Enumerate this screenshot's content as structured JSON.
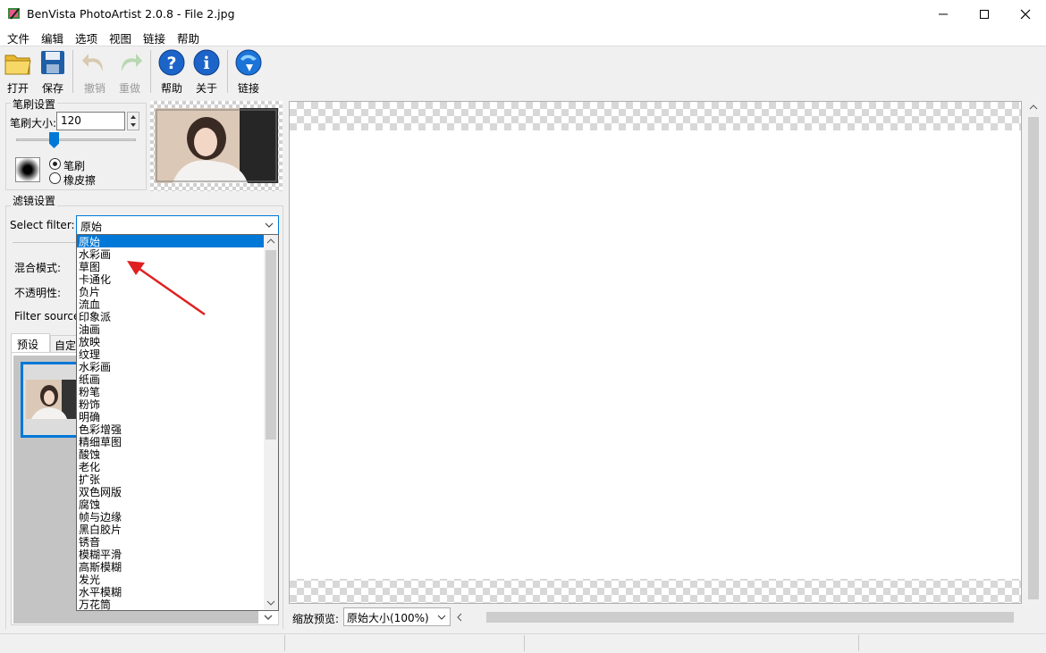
{
  "window": {
    "title": "BenVista PhotoArtist 2.0.8 - File 2.jpg"
  },
  "menu": [
    "文件",
    "编辑",
    "选项",
    "视图",
    "链接",
    "帮助"
  ],
  "toolbar": {
    "open_label": "打开",
    "save_label": "保存",
    "undo_label": "撤销",
    "redo_label": "重做",
    "help_label": "帮助",
    "about_label": "关于",
    "link_label": "链接"
  },
  "brush": {
    "group_title": "笔刷设置",
    "size_label": "笔刷大小:",
    "size_value": "120",
    "mode_brush": "笔刷",
    "mode_eraser": "橡皮擦",
    "selected_mode": "笔刷"
  },
  "filter": {
    "group_title": "滤镜设置",
    "select_label": "Select filter:",
    "selected": "原始",
    "blend_label": "混合模式:",
    "opacity_label": "不透明性:",
    "source_label": "Filter source:",
    "tab_preset": "预设",
    "tab_custom": "自定",
    "options": [
      "原始",
      "水彩画",
      "草图",
      "卡通化",
      "负片",
      "流血",
      "印象派",
      "油画",
      "放映",
      "纹理",
      "水彩画",
      "纸画",
      "粉笔",
      "粉饰",
      "明确",
      "色彩增强",
      "精细草图",
      "酸蚀",
      "老化",
      "扩张",
      "双色网版",
      "腐蚀",
      "帧与边缘",
      "黑白胶片",
      "锈音",
      "模糊平滑",
      "高斯模糊",
      "发光",
      "水平模糊",
      "万花筒"
    ]
  },
  "zoom": {
    "label": "缩放预览:",
    "value": "原始大小(100%)"
  },
  "colors": {
    "accent": "#0078d7",
    "selection": "#0078d7",
    "arrow": "#e02020"
  }
}
